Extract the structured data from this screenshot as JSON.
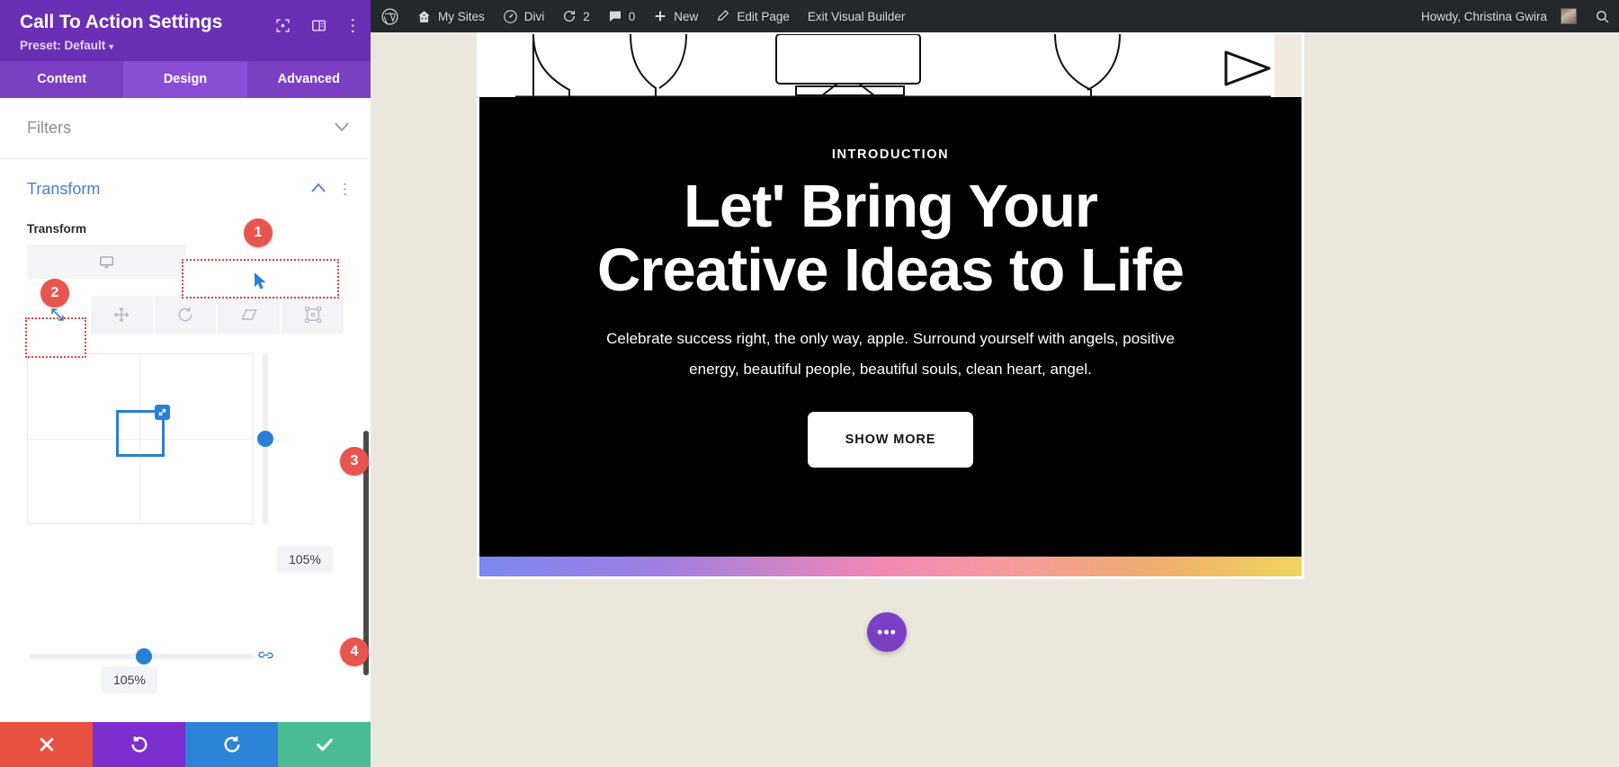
{
  "settings_panel": {
    "title": "Call To Action Settings",
    "preset_label": "Preset: Default",
    "header_icons": [
      "expand-icon",
      "layout-icon",
      "more-vertical-icon"
    ],
    "tabs": [
      {
        "label": "Content",
        "active": false
      },
      {
        "label": "Design",
        "active": true
      },
      {
        "label": "Advanced",
        "active": false
      }
    ],
    "sections": [
      {
        "label": "Filters",
        "open": false
      },
      {
        "label": "Transform",
        "open": true
      }
    ],
    "transform": {
      "field_label": "Transform",
      "device_icons": [
        "desktop-icon"
      ],
      "modes": [
        {
          "name": "scale-icon",
          "active": true
        },
        {
          "name": "move-icon",
          "active": false
        },
        {
          "name": "rotate-icon",
          "active": false
        },
        {
          "name": "skew-icon",
          "active": false
        },
        {
          "name": "origin-icon",
          "active": false
        }
      ],
      "scale_vertical_value": "105%",
      "scale_horizontal_value": "105%",
      "link_icon": "link-axes-icon"
    },
    "footer_buttons": [
      {
        "name": "cancel-button",
        "icon": "close-icon",
        "color": "#e8503f"
      },
      {
        "name": "undo-button",
        "icon": "undo-icon",
        "color": "#7b2fce"
      },
      {
        "name": "redo-button",
        "icon": "redo-icon",
        "color": "#2e84d9"
      },
      {
        "name": "save-button",
        "icon": "check-icon",
        "color": "#4bbd96"
      }
    ],
    "callouts": [
      {
        "number": "1"
      },
      {
        "number": "2"
      },
      {
        "number": "3"
      },
      {
        "number": "4"
      }
    ]
  },
  "admin_bar": {
    "left_items": [
      {
        "label": "",
        "icon": "wordpress-icon"
      },
      {
        "label": "My Sites",
        "icon": "sites-icon"
      },
      {
        "label": "Divi",
        "icon": "divi-icon"
      },
      {
        "label": "2",
        "icon": "updates-icon"
      },
      {
        "label": "0",
        "icon": "comments-icon"
      },
      {
        "label": "New",
        "icon": "plus-icon"
      },
      {
        "label": "Edit Page",
        "icon": "pencil-icon"
      },
      {
        "label": "Exit Visual Builder",
        "icon": ""
      }
    ],
    "greeting": "Howdy, Christina Gwira",
    "avatar": "user-avatar",
    "search_icon": "search-icon"
  },
  "page": {
    "cta": {
      "eyebrow": "INTRODUCTION",
      "heading": "Let' Bring Your Creative Ideas to Life",
      "body": "Celebrate success right, the only way, apple. Surround yourself with angels, positive energy, beautiful people, beautiful souls, clean heart, angel.",
      "button_label": "SHOW MORE"
    },
    "fab": {
      "name": "page-settings-fab",
      "icon": "ellipsis-icon",
      "label": "•••"
    }
  },
  "colors": {
    "brand_purple": "#6b2fb5",
    "tab_purple": "#7b3fc4",
    "accent_blue": "#2a7fd4",
    "callout_red": "#e8554e",
    "canvas_bg": "#ece7dd"
  }
}
